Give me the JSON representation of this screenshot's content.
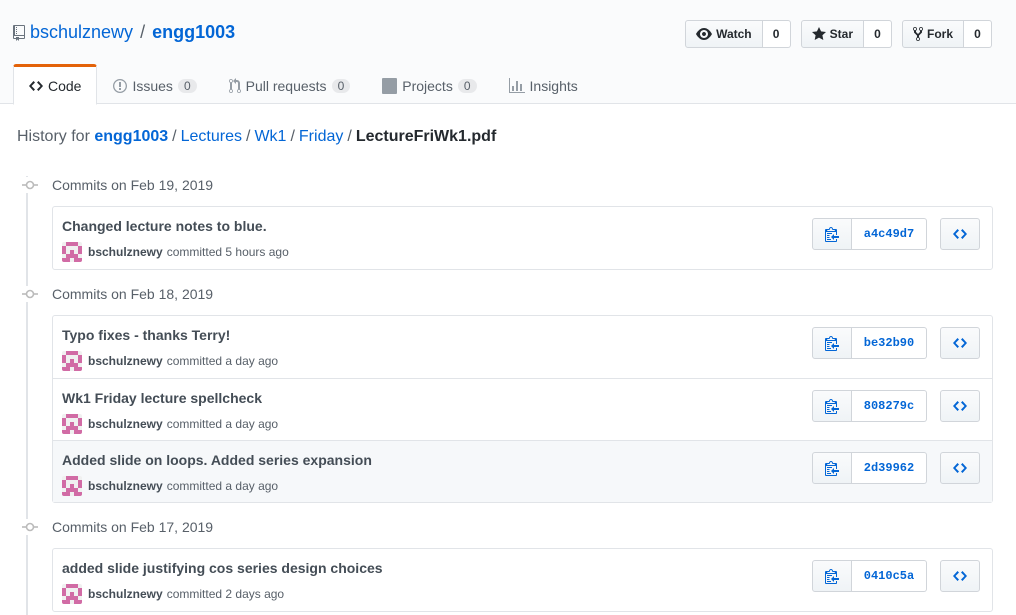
{
  "repo": {
    "owner": "bschulznewy",
    "separator": "/",
    "name": "engg1003"
  },
  "actions": [
    {
      "label": "Watch",
      "count": "0",
      "icon": "eye-icon"
    },
    {
      "label": "Star",
      "count": "0",
      "icon": "star-icon"
    },
    {
      "label": "Fork",
      "count": "0",
      "icon": "fork-icon"
    }
  ],
  "nav": {
    "code": "Code",
    "issues": "Issues",
    "issues_count": "0",
    "pulls": "Pull requests",
    "pulls_count": "0",
    "projects": "Projects",
    "projects_count": "0",
    "insights": "Insights"
  },
  "breadcrumb": {
    "prefix": "History for",
    "repo": "engg1003",
    "sep": "/",
    "parts": [
      "Lectures",
      "Wk1",
      "Friday"
    ],
    "file": "LectureFriWk1.pdf"
  },
  "groups": [
    {
      "date": "Commits on Feb 19, 2019",
      "commits": [
        {
          "title": "Changed lecture notes to blue.",
          "author": "bschulznewy",
          "verb": "committed",
          "time": "5 hours ago",
          "sha": "a4c49d7"
        }
      ]
    },
    {
      "date": "Commits on Feb 18, 2019",
      "commits": [
        {
          "title": "Typo fixes - thanks Terry!",
          "author": "bschulznewy",
          "verb": "committed",
          "time": "a day ago",
          "sha": "be32b90"
        },
        {
          "title": "Wk1 Friday lecture spellcheck",
          "author": "bschulznewy",
          "verb": "committed",
          "time": "a day ago",
          "sha": "808279c"
        },
        {
          "title": "Added slide on loops. Added series expansion",
          "author": "bschulznewy",
          "verb": "committed",
          "time": "a day ago",
          "sha": "2d39962"
        }
      ]
    },
    {
      "date": "Commits on Feb 17, 2019",
      "commits": [
        {
          "title": "added slide justifying cos series design choices",
          "author": "bschulznewy",
          "verb": "committed",
          "time": "2 days ago",
          "sha": "0410c5a"
        }
      ]
    }
  ],
  "colors": {
    "link": "#0366d6",
    "accent": "#e36209",
    "avatar": "#d16ba5"
  }
}
